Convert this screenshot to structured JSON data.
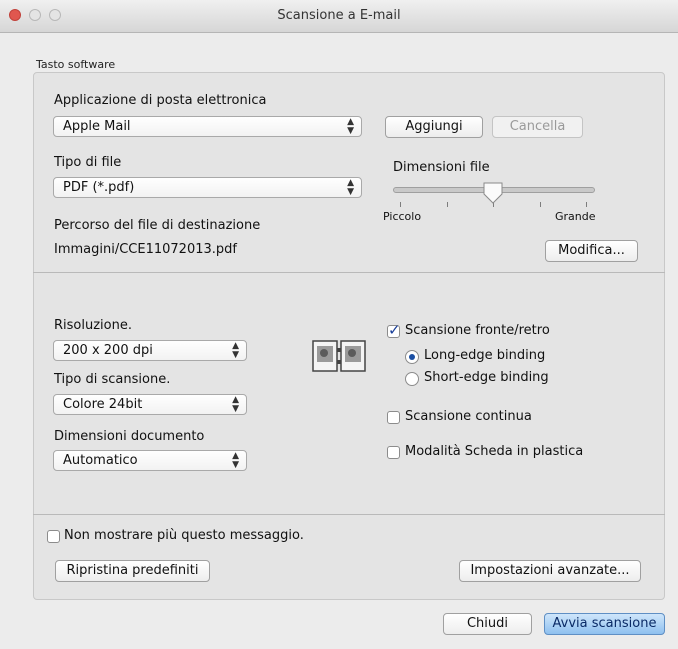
{
  "window": {
    "title": "Scansione a E-mail"
  },
  "group": {
    "label": "Tasto software"
  },
  "email_app": {
    "label": "Applicazione di posta elettronica",
    "value": "Apple Mail",
    "add": "Aggiungi",
    "delete": "Cancella"
  },
  "file_type": {
    "label": "Tipo di file",
    "value": "PDF (*.pdf)"
  },
  "file_size": {
    "label": "Dimensioni file",
    "min_label": "Piccolo",
    "max_label": "Grande",
    "level": 0.5
  },
  "destination": {
    "label": "Percorso del file di destinazione",
    "path": "Immagini/CCE11072013.pdf",
    "edit": "Modifica..."
  },
  "resolution": {
    "label": "Risoluzione.",
    "value": "200 x 200 dpi"
  },
  "scan_type": {
    "label": "Tipo di scansione.",
    "value": "Colore 24bit"
  },
  "doc_size": {
    "label": "Dimensioni documento",
    "value": "Automatico"
  },
  "duplex": {
    "label": "Scansione fronte/retro",
    "checked": true,
    "long_edge": "Long-edge binding",
    "short_edge": "Short-edge binding",
    "selected": "long"
  },
  "continuous": {
    "label": "Scansione continua",
    "checked": false
  },
  "plastic_card": {
    "label": "Modalità Scheda in plastica",
    "checked": false
  },
  "dont_show": {
    "label": "Non mostrare più questo messaggio.",
    "checked": false
  },
  "buttons": {
    "restore": "Ripristina predefiniti",
    "advanced": "Impostazioni avanzate...",
    "close": "Chiudi",
    "start": "Avvia scansione"
  },
  "colors": {
    "primary_button": "#8ec0ef",
    "close_light": "#e0574f",
    "check": "#1a3f99"
  }
}
